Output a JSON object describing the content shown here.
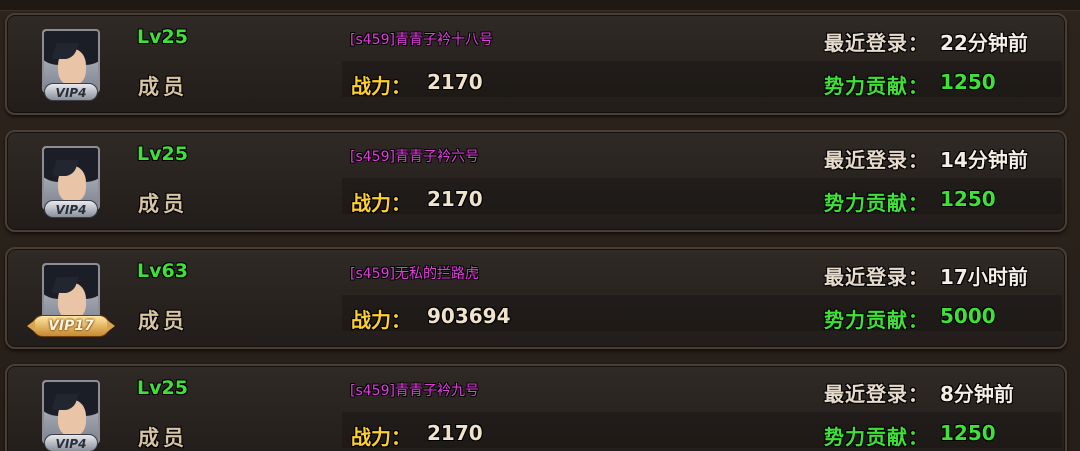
{
  "labels": {
    "power": "战力：",
    "last_login": "最近登录：",
    "contribution": "势力贡献："
  },
  "members": [
    {
      "level": "Lv25",
      "rank": "成员",
      "name": "[s459]青青子衿十八号",
      "power": "2170",
      "last_login": "22分钟前",
      "contribution": "1250",
      "vip": "VIP4"
    },
    {
      "level": "Lv25",
      "rank": "成员",
      "name": "[s459]青青子衿六号",
      "power": "2170",
      "last_login": "14分钟前",
      "contribution": "1250",
      "vip": "VIP4"
    },
    {
      "level": "Lv63",
      "rank": "成员",
      "name": "[s459]无私的拦路虎",
      "power": "903694",
      "last_login": "17小时前",
      "contribution": "5000",
      "vip": "VIP17"
    },
    {
      "level": "Lv25",
      "rank": "成员",
      "name": "[s459]青青子衿九号",
      "power": "2170",
      "last_login": "8分钟前",
      "contribution": "1250",
      "vip": "VIP4"
    }
  ],
  "colors": {
    "level": "#3fe037",
    "name": "#e23ce0",
    "power_label": "#ffcf2e",
    "contribution": "#3fe037",
    "rank": "#d7c4a1"
  },
  "icons": {
    "avatar": "hero-portrait-icon",
    "vip": "vip-badge-icon"
  }
}
